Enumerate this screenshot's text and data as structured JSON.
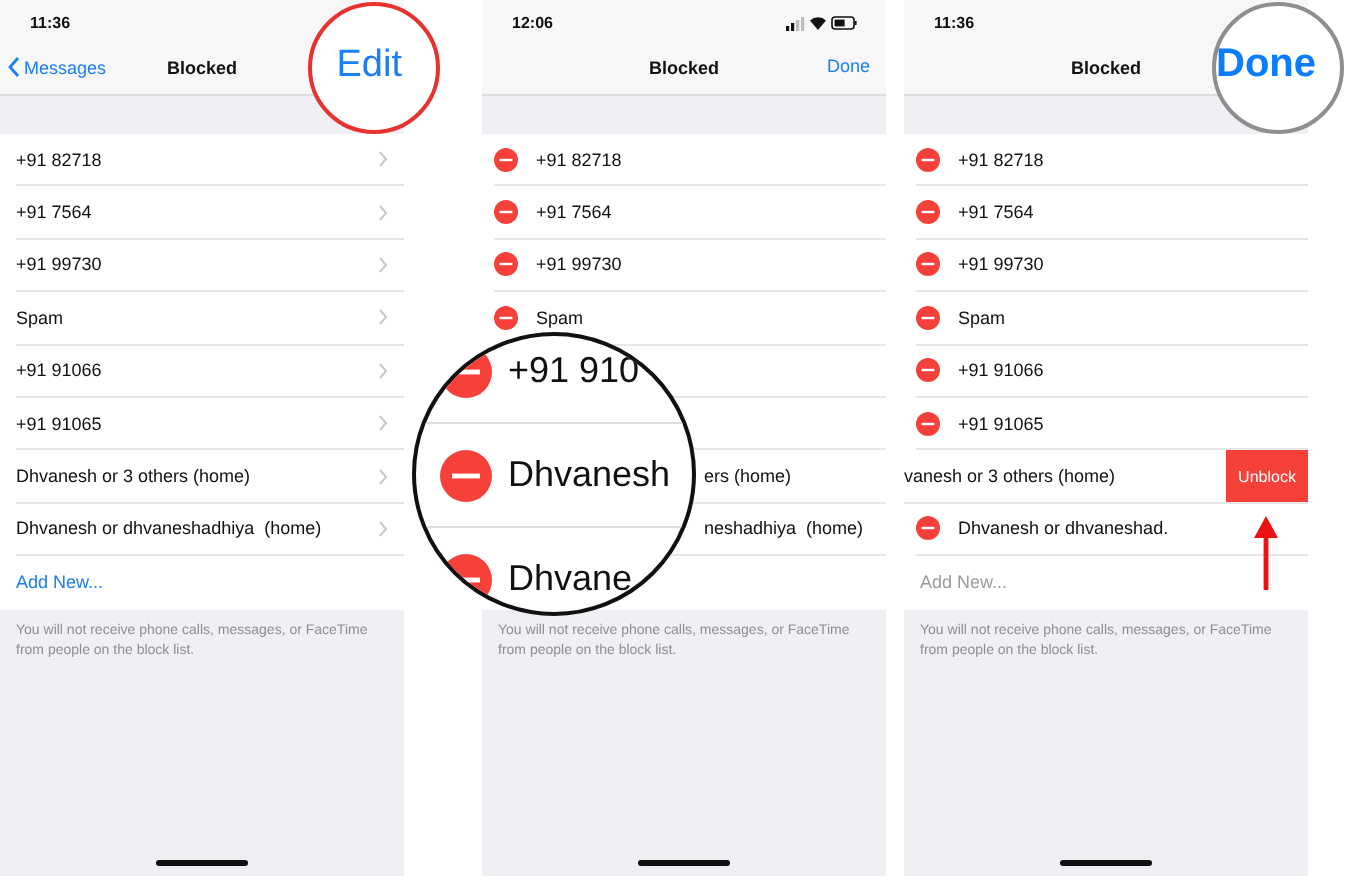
{
  "panels": [
    {
      "status": {
        "time": "11:36",
        "icons": false
      },
      "nav": {
        "back": "Messages",
        "title": "Blocked",
        "action": {
          "label": "Edit",
          "highlight": {
            "color": "#e8322d"
          }
        }
      },
      "rows": [
        {
          "kind": "chevron",
          "text": "+91 82718"
        },
        {
          "kind": "chevron",
          "text": "+91 7564"
        },
        {
          "kind": "chevron",
          "text": "+91 99730"
        },
        {
          "kind": "chevron",
          "text": "Spam"
        },
        {
          "kind": "chevron",
          "text": "+91 91066"
        },
        {
          "kind": "chevron",
          "text": "+91 91065"
        },
        {
          "kind": "chevron",
          "text": "Dhvanesh or 3 others (home)"
        },
        {
          "kind": "chevron",
          "text": "Dhvanesh or dhvaneshadhiya  (home)"
        },
        {
          "kind": "add",
          "text": "Add New...",
          "disabled": false
        }
      ],
      "footer": "You will not receive phone calls, messages, or FaceTime from people on the block list."
    },
    {
      "status": {
        "time": "12:06",
        "icons": true
      },
      "nav": {
        "title": "Blocked",
        "action": {
          "label": "Done"
        }
      },
      "rows": [
        {
          "kind": "delete",
          "text": "+91 82718"
        },
        {
          "kind": "delete",
          "text": "+91 7564"
        },
        {
          "kind": "delete",
          "text": "+91 99730"
        },
        {
          "kind": "delete",
          "text": "Spam"
        },
        {
          "kind": "covered"
        },
        {
          "kind": "covered"
        },
        {
          "kind": "covered",
          "text": "ers (home)"
        },
        {
          "kind": "covered",
          "text": "neshadhiya  (home)"
        },
        {
          "kind": "covered"
        }
      ],
      "magnifier": {
        "rows": [
          {
            "text": "+91 910"
          },
          {
            "text": "Dhvanesh"
          },
          {
            "text": "Dhvane"
          }
        ]
      },
      "footer": "You will not receive phone calls, messages, or FaceTime from people on the block list."
    },
    {
      "status": {
        "time": "11:36",
        "icons": false
      },
      "nav": {
        "title": "Blocked",
        "action": {
          "label": "Done",
          "highlight": {
            "color": "#8e8e8e"
          }
        }
      },
      "rows": [
        {
          "kind": "delete",
          "text": "+91 82718"
        },
        {
          "kind": "delete",
          "text": "+91 7564"
        },
        {
          "kind": "delete",
          "text": "+91 99730"
        },
        {
          "kind": "delete",
          "text": "Spam"
        },
        {
          "kind": "delete",
          "text": "+91 91066"
        },
        {
          "kind": "delete",
          "text": "+91 91065"
        },
        {
          "kind": "swiped",
          "text": "vanesh or 3 others (home)",
          "action": "Unblock"
        },
        {
          "kind": "delete",
          "text": "Dhvanesh or dhvaneshad."
        },
        {
          "kind": "add",
          "text": "Add New...",
          "disabled": true
        }
      ],
      "pointer_arrow": true,
      "footer": "You will not receive phone calls, messages, or FaceTime from people on the block list."
    }
  ]
}
